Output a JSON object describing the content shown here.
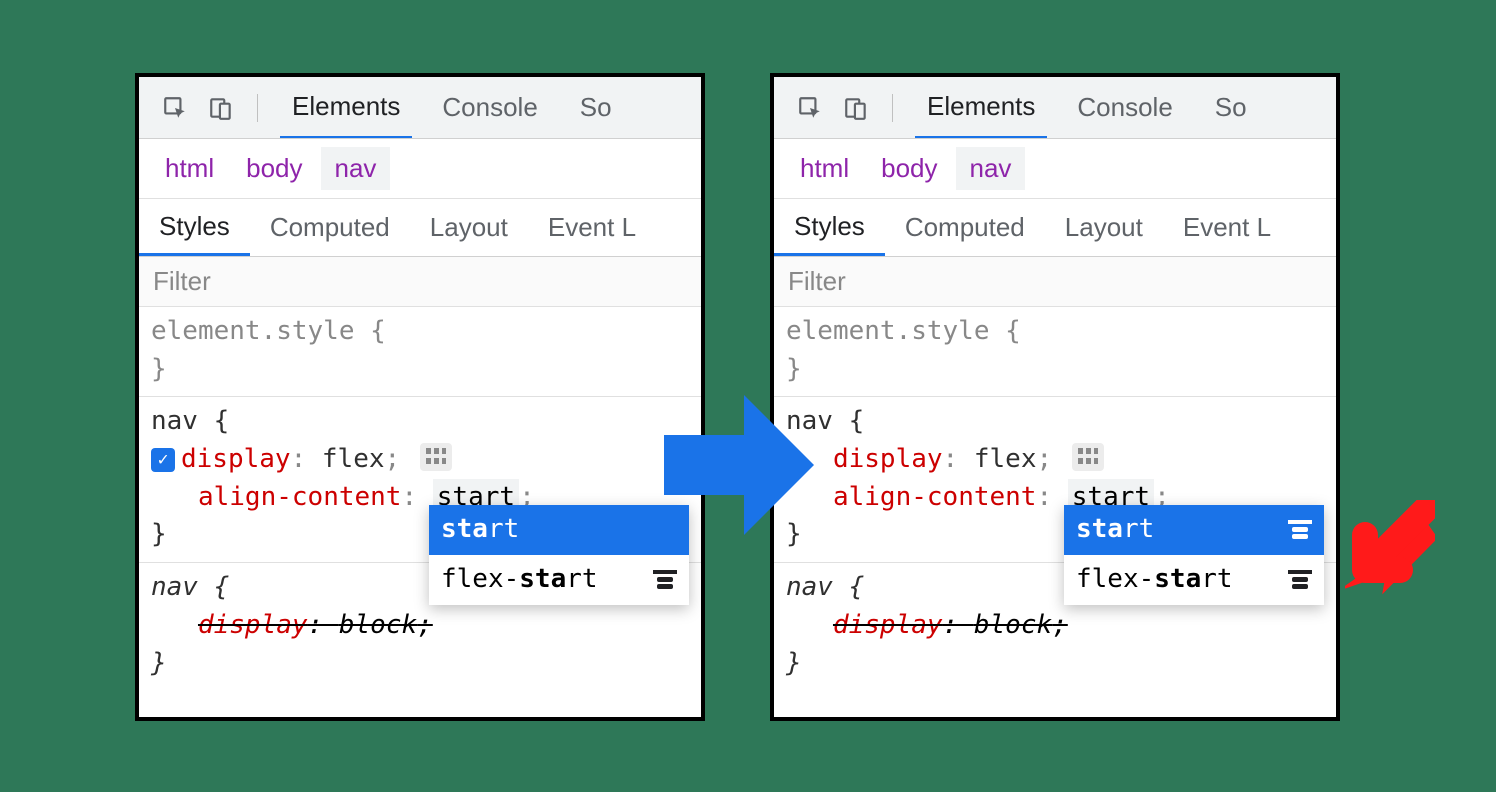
{
  "toolbar": {
    "tabs": {
      "elements": "Elements",
      "console": "Console",
      "sources_partial": "So"
    }
  },
  "breadcrumb": {
    "html": "html",
    "body": "body",
    "nav": "nav"
  },
  "subtabs": {
    "styles": "Styles",
    "computed": "Computed",
    "layout": "Layout",
    "event_partial": "Event L"
  },
  "filter": {
    "placeholder": "Filter"
  },
  "rules": {
    "element_style_open": "element.style {",
    "close": "}",
    "nav_open": "nav {",
    "display_prop": "display",
    "display_val": "flex",
    "align_prop": "align-content",
    "align_val_prefix": "sta",
    "align_val_rest": "rt",
    "semicolon": ";",
    "colon": ": ",
    "ua_nav_open": "nav {",
    "ua_display_prop": "display",
    "ua_display_val": "block",
    "ua_display_sep": ": "
  },
  "dropdown": {
    "opt1_bold": "sta",
    "opt1_rest": "rt",
    "opt2_pre": "flex-",
    "opt2_bold": "sta",
    "opt2_rest": "rt"
  }
}
